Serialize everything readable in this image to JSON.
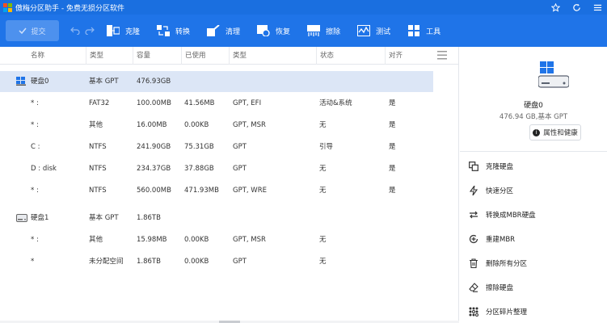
{
  "titlebar": {
    "title": "傲梅分区助手 - 免费无损分区软件",
    "icons": [
      "star-icon",
      "refresh-icon",
      "menu-icon"
    ]
  },
  "toolbar": {
    "submit_label": "提交",
    "tools": [
      {
        "label": "克隆",
        "icon": "clone-icon"
      },
      {
        "label": "转换",
        "icon": "convert-icon"
      },
      {
        "label": "清理",
        "icon": "clean-icon"
      },
      {
        "label": "恢复",
        "icon": "recover-icon"
      },
      {
        "label": "擦除",
        "icon": "wipe-icon"
      },
      {
        "label": "测试",
        "icon": "test-icon"
      },
      {
        "label": "工具",
        "icon": "tools-icon"
      }
    ]
  },
  "table": {
    "headers": [
      "名称",
      "类型",
      "容量",
      "已使用",
      "类型",
      "状态",
      "对齐"
    ],
    "rows": [
      {
        "kind": "disk",
        "name": "硬盘0",
        "type": "基本 GPT",
        "capacity": "476.93GB",
        "used": "",
        "ptype": "",
        "status": "",
        "align": ""
      },
      {
        "kind": "part",
        "name": "* :",
        "type": "FAT32",
        "capacity": "100.00MB",
        "used": "41.56MB",
        "ptype": "GPT, EFI",
        "status": "活动&系统",
        "align": "是"
      },
      {
        "kind": "part",
        "name": "* :",
        "type": "其他",
        "capacity": "16.00MB",
        "used": "0.00KB",
        "ptype": "GPT, MSR",
        "status": "无",
        "align": "是"
      },
      {
        "kind": "part",
        "name": "C :",
        "type": "NTFS",
        "capacity": "241.90GB",
        "used": "75.31GB",
        "ptype": "GPT",
        "status": "引导",
        "align": "是"
      },
      {
        "kind": "part",
        "name": "D : disk",
        "type": "NTFS",
        "capacity": "234.37GB",
        "used": "37.88GB",
        "ptype": "GPT",
        "status": "无",
        "align": "是"
      },
      {
        "kind": "part",
        "name": "* :",
        "type": "NTFS",
        "capacity": "560.00MB",
        "used": "471.93MB",
        "ptype": "GPT, WRE",
        "status": "无",
        "align": "是"
      },
      {
        "kind": "disk2",
        "name": "硬盘1",
        "type": "基本 GPT",
        "capacity": "1.86TB",
        "used": "",
        "ptype": "",
        "status": "",
        "align": ""
      },
      {
        "kind": "part",
        "name": "* :",
        "type": "其他",
        "capacity": "15.98MB",
        "used": "0.00KB",
        "ptype": "GPT, MSR",
        "status": "无",
        "align": ""
      },
      {
        "kind": "part",
        "name": "*",
        "type": "未分配空间",
        "capacity": "1.86TB",
        "used": "0.00KB",
        "ptype": "GPT",
        "status": "无",
        "align": ""
      }
    ]
  },
  "panel": {
    "disk_name": "硬盘0",
    "disk_info": "476.94 GB,基本 GPT",
    "prop_label": "属性和健康",
    "ops": [
      {
        "label": "克隆硬盘",
        "icon": "clone-disk-icon"
      },
      {
        "label": "快速分区",
        "icon": "quick-partition-icon"
      },
      {
        "label": "转换成MBR硬盘",
        "icon": "convert-mbr-icon"
      },
      {
        "label": "重建MBR",
        "icon": "rebuild-mbr-icon"
      },
      {
        "label": "删除所有分区",
        "icon": "delete-all-icon"
      },
      {
        "label": "擦除硬盘",
        "icon": "wipe-disk-icon"
      },
      {
        "label": "分区碎片整理",
        "icon": "defrag-icon"
      }
    ]
  },
  "colors": {
    "accent": "#1f74e8",
    "selected_row": "#dce6f6"
  }
}
